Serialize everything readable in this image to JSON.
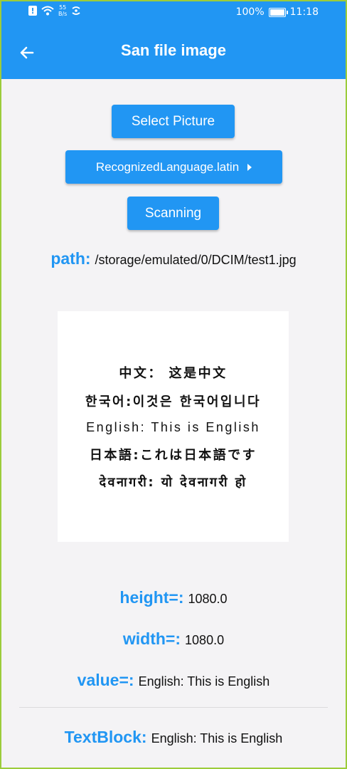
{
  "status_bar": {
    "net_speed_value": "55",
    "net_speed_unit": "B/s",
    "battery_percent": "100%",
    "time": "11:18"
  },
  "app_bar": {
    "title": "San file image"
  },
  "buttons": {
    "select_picture": "Select Picture",
    "language": "RecognizedLanguage.latin",
    "scanning": "Scanning"
  },
  "path": {
    "label": "path:",
    "value": "/storage/emulated/0/DCIM/test1.jpg"
  },
  "image_text": {
    "lines": [
      "中文： 这是中文",
      "한국어:이것은 한국어입니다",
      "English: This is English",
      "日本語:これは日本語です",
      "देवनागरी: यो देवनागरी हो"
    ]
  },
  "results": {
    "height_label": "height=:",
    "height_value": "1080.0",
    "width_label": "width=:",
    "width_value": "1080.0",
    "value_label": "value=:",
    "value_value": "English: This is English",
    "textblock_label": "TextBlock:",
    "textblock_value": "English: This is English"
  },
  "colors": {
    "accent": "#2196f3",
    "background": "#f4f3f5",
    "frame": "#9ccc3a"
  },
  "icons": {
    "back": "arrow-left-icon",
    "dropdown": "caret-right-icon",
    "wifi": "wifi-icon",
    "battery": "battery-icon"
  }
}
